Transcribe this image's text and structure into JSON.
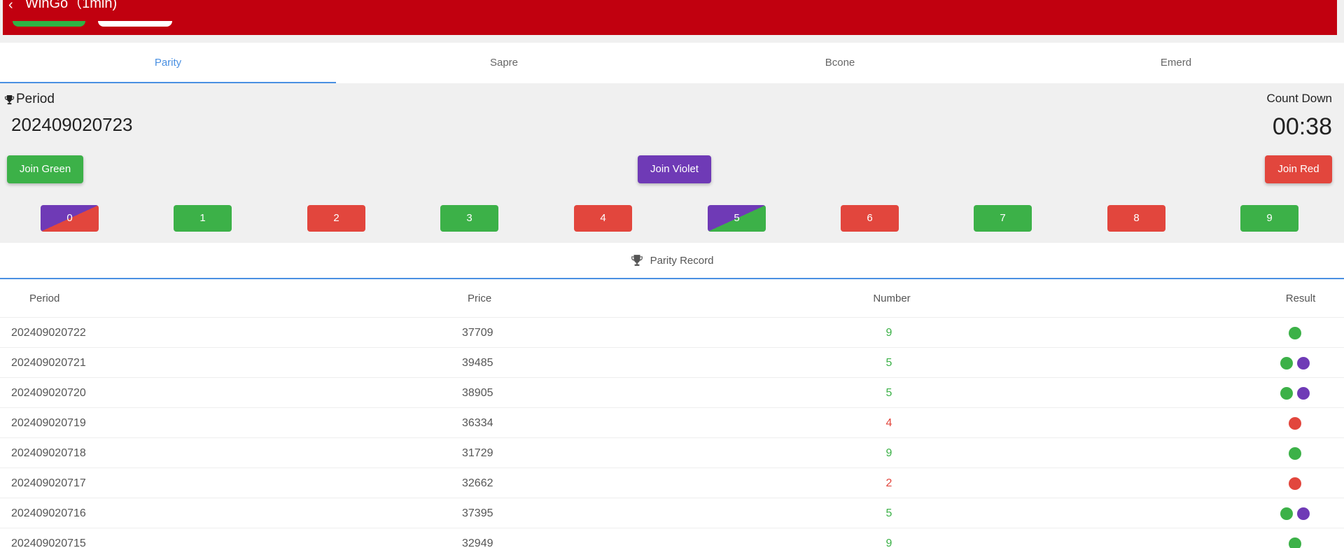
{
  "header": {
    "back_icon": "chevron-left-icon",
    "title": "WinGo（1min)",
    "brand_color": "#c1000f"
  },
  "tabs": [
    {
      "label": "Parity",
      "active": true
    },
    {
      "label": "Sapre",
      "active": false
    },
    {
      "label": "Bcone",
      "active": false
    },
    {
      "label": "Emerd",
      "active": false
    }
  ],
  "game": {
    "period_label": "Period",
    "period_value": "202409020723",
    "countdown_label": "Count Down",
    "countdown_value": "00:38",
    "join_green": "Join Green",
    "join_violet": "Join Violet",
    "join_red": "Join Red",
    "numbers": [
      {
        "label": "0",
        "color": "violet-red"
      },
      {
        "label": "1",
        "color": "green"
      },
      {
        "label": "2",
        "color": "red"
      },
      {
        "label": "3",
        "color": "green"
      },
      {
        "label": "4",
        "color": "red"
      },
      {
        "label": "5",
        "color": "violet-green"
      },
      {
        "label": "6",
        "color": "red"
      },
      {
        "label": "7",
        "color": "green"
      },
      {
        "label": "8",
        "color": "red"
      },
      {
        "label": "9",
        "color": "green"
      }
    ],
    "colors": {
      "green": "#3cb148",
      "red": "#e2463d",
      "violet": "#6f3ab6"
    }
  },
  "record": {
    "title": "Parity Record",
    "title_icon": "trophy-icon",
    "columns": [
      "Period",
      "Price",
      "Number",
      "Result"
    ],
    "rows": [
      {
        "period": "202409020722",
        "price": "37709",
        "number": "9",
        "number_color": "green",
        "result": [
          "green"
        ]
      },
      {
        "period": "202409020721",
        "price": "39485",
        "number": "5",
        "number_color": "green",
        "result": [
          "green",
          "violet"
        ]
      },
      {
        "period": "202409020720",
        "price": "38905",
        "number": "5",
        "number_color": "green",
        "result": [
          "green",
          "violet"
        ]
      },
      {
        "period": "202409020719",
        "price": "36334",
        "number": "4",
        "number_color": "red",
        "result": [
          "red"
        ]
      },
      {
        "period": "202409020718",
        "price": "31729",
        "number": "9",
        "number_color": "green",
        "result": [
          "green"
        ]
      },
      {
        "period": "202409020717",
        "price": "32662",
        "number": "2",
        "number_color": "red",
        "result": [
          "red"
        ]
      },
      {
        "period": "202409020716",
        "price": "37395",
        "number": "5",
        "number_color": "green",
        "result": [
          "green",
          "violet"
        ]
      },
      {
        "period": "202409020715",
        "price": "32949",
        "number": "9",
        "number_color": "green",
        "result": [
          "green"
        ]
      }
    ]
  }
}
